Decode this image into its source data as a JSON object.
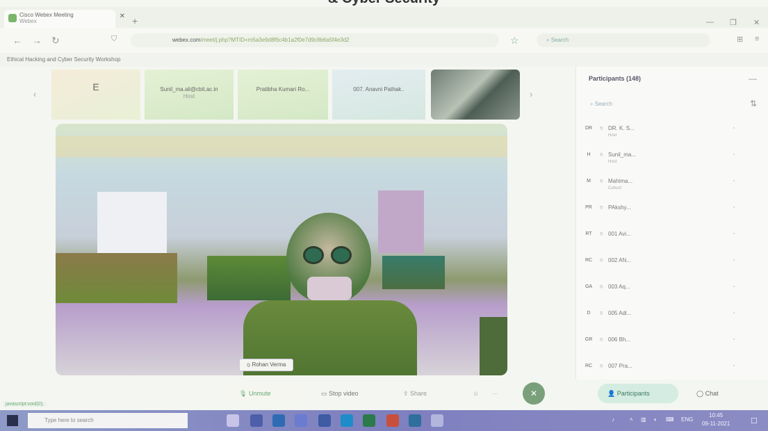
{
  "caption": "& Cyber Security",
  "browser": {
    "tab_title": "Cisco Webex Meeting",
    "tab_subtitle": "Webex",
    "new_tab": "+",
    "url_domain": "webex.com",
    "url_rest": "/meet/j.php?MTID=m5a3e9d8f6c4b1a2f0e7d9c8b6a5f4e3d2",
    "search_placeholder": "Search",
    "bookmark": "Ethical Hacking and Cyber Security Workshop"
  },
  "thumbnails": [
    {
      "label": "E"
    },
    {
      "label": "Sunil_ma.ali@cbit.ac.in",
      "sub": "Host"
    },
    {
      "label": "Pratibha Kumari Ro..."
    },
    {
      "label": "007. Anavni Pathak.."
    }
  ],
  "main_video": {
    "speaker_name": "Rohan Verma"
  },
  "participants": {
    "title": "Participants (148)",
    "search_placeholder": "Search",
    "rows": [
      {
        "initials": "DR",
        "name": "DR. K. S...",
        "role": "Host"
      },
      {
        "initials": "H",
        "name": "Sunil_ma...",
        "role": "Host"
      },
      {
        "initials": "M",
        "name": "Mahima...",
        "role": "Cohost"
      },
      {
        "initials": "PR",
        "name": "PAkshy...",
        "role": ""
      },
      {
        "initials": "RT",
        "name": "001 Avi...",
        "role": ""
      },
      {
        "initials": "RC",
        "name": "002 AN...",
        "role": ""
      },
      {
        "initials": "GA",
        "name": "003 Aq...",
        "role": ""
      },
      {
        "initials": "D",
        "name": "005 Adi...",
        "role": ""
      },
      {
        "initials": "GR",
        "name": "006 Bh...",
        "role": ""
      },
      {
        "initials": "RC",
        "name": "007 Pra...",
        "role": ""
      }
    ]
  },
  "controls": {
    "unmute": "Unmute",
    "video": "Stop video",
    "share": "Share",
    "participants": "Participants",
    "chat": "Chat"
  },
  "status_url": "javascript:void(0);",
  "taskbar": {
    "search": "Type here to search",
    "lang": "ENG",
    "time": "10:45",
    "date": "09-11-2021"
  }
}
